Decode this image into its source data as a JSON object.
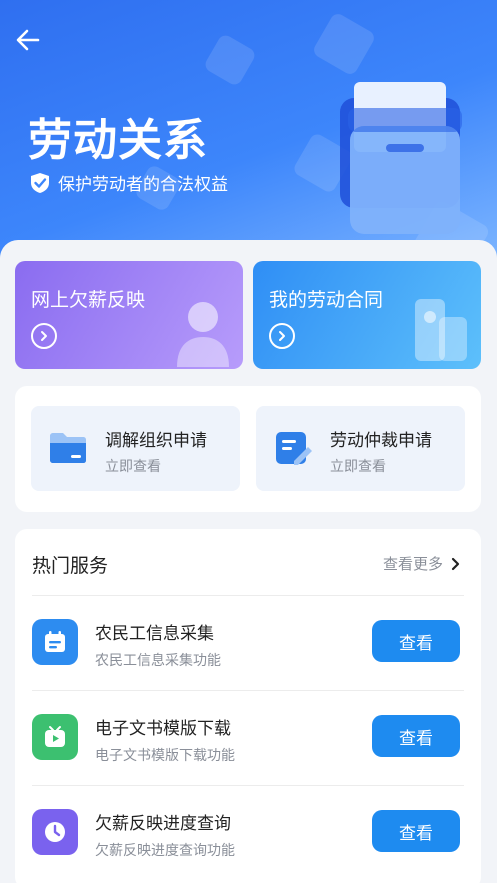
{
  "header": {
    "title": "劳动关系",
    "subtitle": "保护劳动者的合法权益",
    "back_icon": "arrow-left-icon",
    "shield_icon": "shield-check-icon"
  },
  "quick_cards": [
    {
      "label": "网上欠薪反映",
      "icon": "user-avatar-icon",
      "color": "#8a6cf0"
    },
    {
      "label": "我的劳动合同",
      "icon": "document-stack-icon",
      "color": "#2f8ef5"
    }
  ],
  "applications": [
    {
      "title": "调解组织申请",
      "subtitle": "立即查看",
      "icon": "folder-icon"
    },
    {
      "title": "劳动仲裁申请",
      "subtitle": "立即查看",
      "icon": "edit-form-icon"
    }
  ],
  "hot_services": {
    "title": "热门服务",
    "more_label": "查看更多",
    "items": [
      {
        "name": "农民工信息采集",
        "desc": "农民工信息采集功能",
        "button": "查看",
        "icon": "calendar-icon",
        "color": "#2d8cf0"
      },
      {
        "name": "电子文书模版下载",
        "desc": "电子文书模版下载功能",
        "button": "查看",
        "icon": "video-play-icon",
        "color": "#3cc070"
      },
      {
        "name": "欠薪反映进度查询",
        "desc": "欠薪反映进度查询功能",
        "button": "查看",
        "icon": "clock-icon",
        "color": "#7a62ee"
      }
    ]
  }
}
